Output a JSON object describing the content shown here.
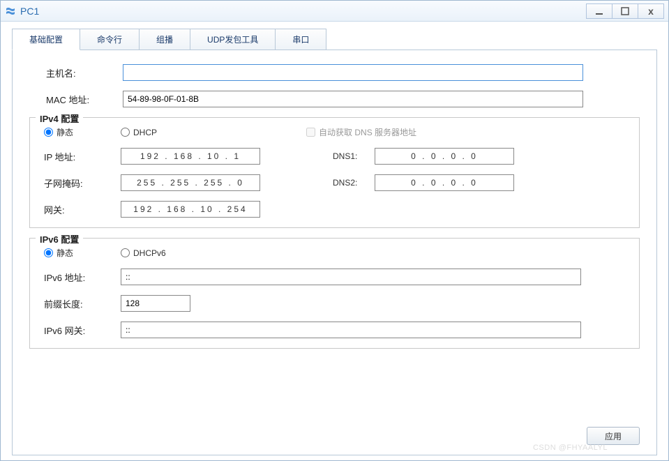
{
  "window": {
    "title": "PC1"
  },
  "tabs": {
    "items": [
      "基础配置",
      "命令行",
      "组播",
      "UDP发包工具",
      "串口"
    ],
    "active_index": 0
  },
  "basic": {
    "hostname_label": "主机名:",
    "hostname_value": "",
    "mac_label": "MAC 地址:",
    "mac_value": "54-89-98-0F-01-8B"
  },
  "ipv4": {
    "legend": "IPv4 配置",
    "static_label": "静态",
    "dhcp_label": "DHCP",
    "mode": "static",
    "auto_dns_label": "自动获取 DNS 服务器地址",
    "auto_dns_checked": false,
    "ip_label": "IP 地址:",
    "ip_value": "192 . 168 . 10 .  1",
    "mask_label": "子网掩码:",
    "mask_value": "255 . 255 . 255 .  0",
    "gateway_label": "网关:",
    "gateway_value": "192 . 168 . 10 . 254",
    "dns1_label": "DNS1:",
    "dns1_value": "0  .  0  .  0  .  0",
    "dns2_label": "DNS2:",
    "dns2_value": "0  .  0  .  0  .  0"
  },
  "ipv6": {
    "legend": "IPv6 配置",
    "static_label": "静态",
    "dhcp_label": "DHCPv6",
    "mode": "static",
    "addr_label": "IPv6 地址:",
    "addr_value": "::",
    "prefix_label": "前缀长度:",
    "prefix_value": "128",
    "gateway_label": "IPv6 网关:",
    "gateway_value": "::"
  },
  "footer": {
    "apply_label": "应用"
  },
  "watermark": "CSDN @FHYAALYL"
}
